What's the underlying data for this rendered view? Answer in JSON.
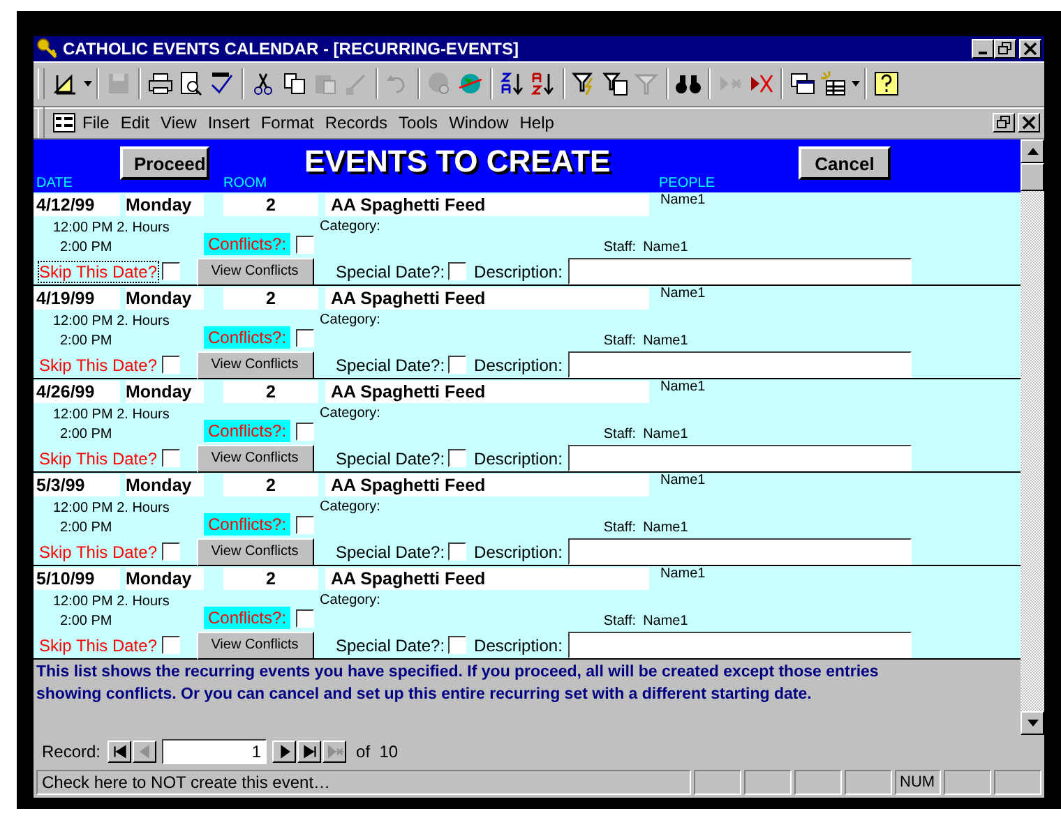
{
  "window": {
    "title": "CATHOLIC EVENTS CALENDAR - [RECURRING-EVENTS]"
  },
  "menu": [
    {
      "label": "File"
    },
    {
      "label": "Edit"
    },
    {
      "label": "View"
    },
    {
      "label": "Insert"
    },
    {
      "label": "Format"
    },
    {
      "label": "Records"
    },
    {
      "label": "Tools"
    },
    {
      "label": "Window"
    },
    {
      "label": "Help"
    }
  ],
  "header": {
    "title": "EVENTS TO CREATE",
    "proceed_button": "Proceed",
    "cancel_button": "Cancel",
    "columns": [
      "DATE",
      "ROOM",
      "PEOPLE"
    ]
  },
  "records": [
    {
      "date": "4/12/99",
      "day": "Monday",
      "room": "2",
      "title": "AA Spaghetti Feed",
      "people": "Name1",
      "start": "12:00 PM",
      "duration": "2. Hours",
      "end": "2:00 PM",
      "category_label": "Category:",
      "staff_label": "Staff:",
      "staff": "Name1",
      "conflicts_label": "Conflicts?:",
      "conflicts": false,
      "skip_label": "Skip This Date?",
      "skip": false,
      "focused": true,
      "view_button": "View Conflicts",
      "special_label": "Special Date?:",
      "special": false,
      "description_label": "Description:"
    },
    {
      "date": "4/19/99",
      "day": "Monday",
      "room": "2",
      "title": "AA Spaghetti Feed",
      "people": "Name1",
      "start": "12:00 PM",
      "duration": "2. Hours",
      "end": "2:00 PM",
      "category_label": "Category:",
      "staff_label": "Staff:",
      "staff": "Name1",
      "conflicts_label": "Conflicts?:",
      "conflicts": false,
      "skip_label": "Skip This Date?",
      "skip": false,
      "focused": false,
      "view_button": "View Conflicts",
      "special_label": "Special Date?:",
      "special": false,
      "description_label": "Description:"
    },
    {
      "date": "4/26/99",
      "day": "Monday",
      "room": "2",
      "title": "AA Spaghetti Feed",
      "people": "Name1",
      "start": "12:00 PM",
      "duration": "2. Hours",
      "end": "2:00 PM",
      "category_label": "Category:",
      "staff_label": "Staff:",
      "staff": "Name1",
      "conflicts_label": "Conflicts?:",
      "conflicts": false,
      "skip_label": "Skip This Date?",
      "skip": false,
      "focused": false,
      "view_button": "View Conflicts",
      "special_label": "Special Date?:",
      "special": false,
      "description_label": "Description:"
    },
    {
      "date": "5/3/99",
      "day": "Monday",
      "room": "2",
      "title": "AA Spaghetti Feed",
      "people": "Name1",
      "start": "12:00 PM",
      "duration": "2. Hours",
      "end": "2:00 PM",
      "category_label": "Category:",
      "staff_label": "Staff:",
      "staff": "Name1",
      "conflicts_label": "Conflicts?:",
      "conflicts": false,
      "skip_label": "Skip This Date?",
      "skip": false,
      "focused": false,
      "view_button": "View Conflicts",
      "special_label": "Special Date?:",
      "special": false,
      "description_label": "Description:"
    },
    {
      "date": "5/10/99",
      "day": "Monday",
      "room": "2",
      "title": "AA Spaghetti Feed",
      "people": "Name1",
      "start": "12:00 PM",
      "duration": "2. Hours",
      "end": "2:00 PM",
      "category_label": "Category:",
      "staff_label": "Staff:",
      "staff": "Name1",
      "conflicts_label": "Conflicts?:",
      "conflicts": false,
      "skip_label": "Skip This Date?",
      "skip": false,
      "focused": false,
      "view_button": "View Conflicts",
      "special_label": "Special Date?:",
      "special": false,
      "description_label": "Description:"
    }
  ],
  "footer_note": "This list shows the recurring events you have specified.  If you proceed, all will be created except those entries showing conflicts.  Or you can cancel and set up this entire recurring set with a different starting date.",
  "navigator": {
    "label": "Record:",
    "value": "1",
    "of_label": "of",
    "total": "10"
  },
  "status_bar": {
    "message": "Check here to NOT create this event…",
    "num_indicator": "NUM"
  }
}
